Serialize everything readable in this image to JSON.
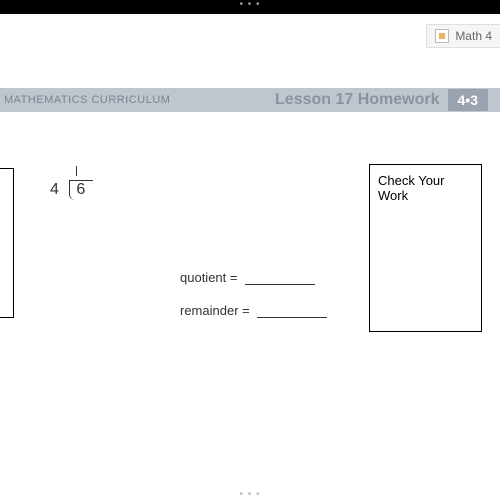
{
  "topbar": {
    "ellipsis": "• • •"
  },
  "topRightTag": {
    "label": "Math 4"
  },
  "curriculumBar": {
    "label": "MATHEMATICS CURRICULUM",
    "lessonTitle": "Lesson 17 Homework",
    "badge": "4•3"
  },
  "division": {
    "divisor": "4",
    "dividend": "6"
  },
  "answers": {
    "quotientLabel": "quotient =",
    "remainderLabel": "remainder ="
  },
  "checkBox": {
    "title": "Check Your Work"
  },
  "bottom": {
    "ellipsis": "• • •"
  }
}
